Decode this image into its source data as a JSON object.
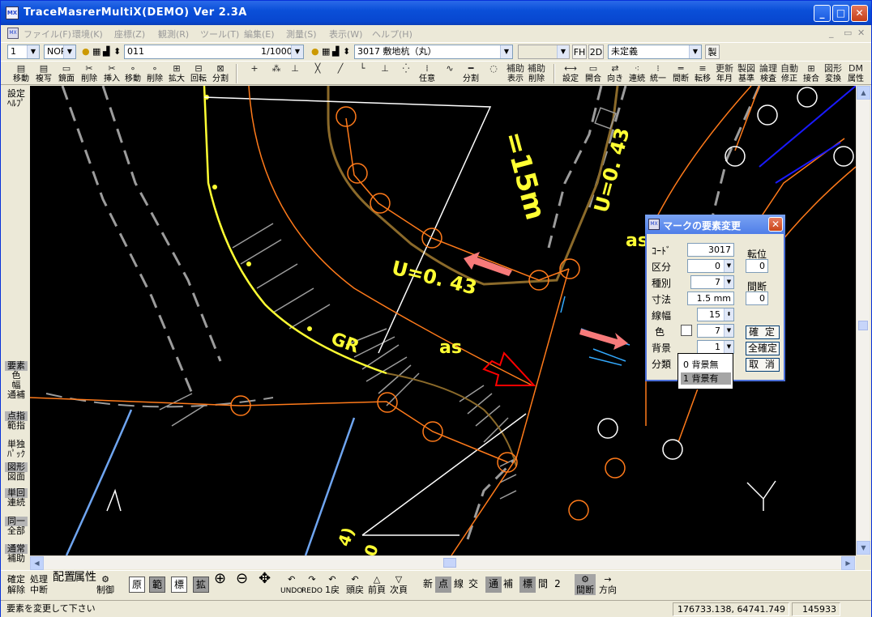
{
  "window": {
    "title": "TraceMasrerMultiX(DEMO) Ver 2.3A",
    "app_icon": "MX",
    "min": "_",
    "max": "□",
    "close": "✕"
  },
  "menu": {
    "items": [
      "ファイル(F)",
      "環境(K)",
      "座標(Z)",
      "観測(R)",
      "ツール(T)",
      "編集(E)",
      "測量(S)",
      "表示(W)",
      "ヘルプ(H)"
    ],
    "mdi": [
      "_",
      "▭",
      "✕"
    ]
  },
  "toolbar1": {
    "layer": "1",
    "mode": "NOR",
    "code_layer": "011",
    "scale": "1/1000",
    "code_element": "3017 敷地杭（丸）",
    "blank": "",
    "fh": "FH",
    "td": "2D",
    "undefined": "未定義",
    "make": "製"
  },
  "toolbar2": [
    {
      "glyph": "▤",
      "label": "移動"
    },
    {
      "glyph": "▤",
      "label": "複写"
    },
    {
      "glyph": "▭",
      "label": "鏡面"
    },
    {
      "glyph": "✂",
      "label": "削除"
    },
    {
      "glyph": "✂",
      "label": "挿入"
    },
    {
      "glyph": "∘",
      "label": "移動"
    },
    {
      "glyph": "∘",
      "label": "削除"
    },
    {
      "glyph": "⊞",
      "label": "拡大"
    },
    {
      "glyph": "⊟",
      "label": "回転"
    },
    {
      "glyph": "⊠",
      "label": "分割"
    },
    {
      "glyph": "+",
      "label": ""
    },
    {
      "glyph": "⁂",
      "label": ""
    },
    {
      "glyph": "⊥",
      "label": ""
    },
    {
      "glyph": "╳",
      "label": ""
    },
    {
      "glyph": "╱",
      "label": ""
    },
    {
      "glyph": "└",
      "label": ""
    },
    {
      "glyph": "⊥",
      "label": ""
    },
    {
      "glyph": "⁛",
      "label": ""
    },
    {
      "glyph": "⁞",
      "label": "任意"
    },
    {
      "glyph": "∿",
      "label": ""
    },
    {
      "glyph": "━",
      "label": "分割"
    },
    {
      "glyph": "◌",
      "label": ""
    },
    {
      "glyph": "補助",
      "label": "表示"
    },
    {
      "glyph": "補助",
      "label": "削除"
    },
    {
      "glyph": "⟷",
      "label": "設定"
    },
    {
      "glyph": "▭",
      "label": "開合"
    },
    {
      "glyph": "⇄",
      "label": "向き"
    },
    {
      "glyph": "⁖",
      "label": "連続"
    },
    {
      "glyph": "⁝",
      "label": "統一"
    },
    {
      "glyph": "═",
      "label": "間断"
    },
    {
      "glyph": "≡",
      "label": "転移"
    },
    {
      "glyph": "更新",
      "label": "年月"
    },
    {
      "glyph": "製図",
      "label": "基準"
    },
    {
      "glyph": "論理",
      "label": "検査"
    },
    {
      "glyph": "自動",
      "label": "修正"
    },
    {
      "glyph": "⊞",
      "label": "接合"
    },
    {
      "glyph": "図形",
      "label": "変換"
    },
    {
      "glyph": "DM",
      "label": "属性"
    }
  ],
  "sidebar": [
    [
      "設定",
      "ﾍﾙﾌﾟ"
    ],
    [
      "要素",
      "色",
      "幅",
      "通補"
    ],
    [
      "点指",
      "範指"
    ],
    [
      "単独",
      "ﾊﾟｯｸ"
    ],
    [
      "図形",
      "図面"
    ],
    [
      "単回",
      "連続"
    ],
    [
      "同一",
      "全部"
    ],
    [
      "通常",
      "補助"
    ]
  ],
  "canvas_labels": {
    "v1": "=15m",
    "u1": "U=0. 43",
    "u2": "U=0. 43",
    "gr": "GR",
    "as1": "as",
    "as2": "as",
    "num": "4)",
    "zero": "0"
  },
  "colors": {
    "orange": "#ff7a1a",
    "yellow": "#ffff33",
    "white": "#ffffff",
    "brown": "#8b6a2a",
    "gray": "#9c9c9c",
    "blue": "#6fa5f0",
    "darkblue": "#1a1aff",
    "pink": "#f77a7a",
    "red": "#ff0000",
    "cyan": "#33aaff"
  },
  "dialog": {
    "title": "マークの要素変更",
    "code_label": "ｺｰﾄﾞ",
    "code": "3017",
    "rotate_label": "転位",
    "rotate": "0",
    "kubun_label": "区分",
    "kubun": "0",
    "shubetsu_label": "種別",
    "shubetsu": "7",
    "kandan_label": "間断",
    "kandan": "0",
    "size_label": "寸法",
    "size": "1.5 mm",
    "width_label": "線幅",
    "width": "15",
    "color_label": "色",
    "color": "7",
    "bg_label": "背景",
    "bg": "1",
    "bunrui_label": "分類",
    "confirm": "確 定",
    "all_confirm": "全確定",
    "cancel": "取 消",
    "bg_options": [
      "0 背景無",
      "1 背景有"
    ]
  },
  "toolbar3": {
    "items": [
      [
        "確定",
        "解除"
      ],
      [
        "処理",
        "中断"
      ],
      [
        "配",
        "置"
      ],
      [
        "属",
        "性"
      ],
      [
        "⚙",
        "制御"
      ]
    ],
    "keys": [
      "原",
      "範",
      "標",
      "拡"
    ],
    "tools": [
      [
        "",
        ""
      ],
      [
        "",
        ""
      ],
      [
        "",
        ""
      ],
      [
        "↶",
        "UNDO"
      ],
      [
        "↷",
        "REDO"
      ],
      [
        "↶",
        "1戻"
      ],
      [
        "↶",
        "頭戻"
      ],
      [
        "△",
        "前頁"
      ],
      [
        "▽",
        "次頁"
      ]
    ],
    "modes": [
      "新",
      "点",
      "線",
      "交",
      "通",
      "補",
      "標",
      "間",
      "2"
    ],
    "spacing": [
      "⚙",
      "間断"
    ],
    "direction": [
      "→",
      "方向"
    ]
  },
  "status": {
    "message": "要素を変更して下さい",
    "coords": "176733.138,  64741.749",
    "count": "145933"
  }
}
